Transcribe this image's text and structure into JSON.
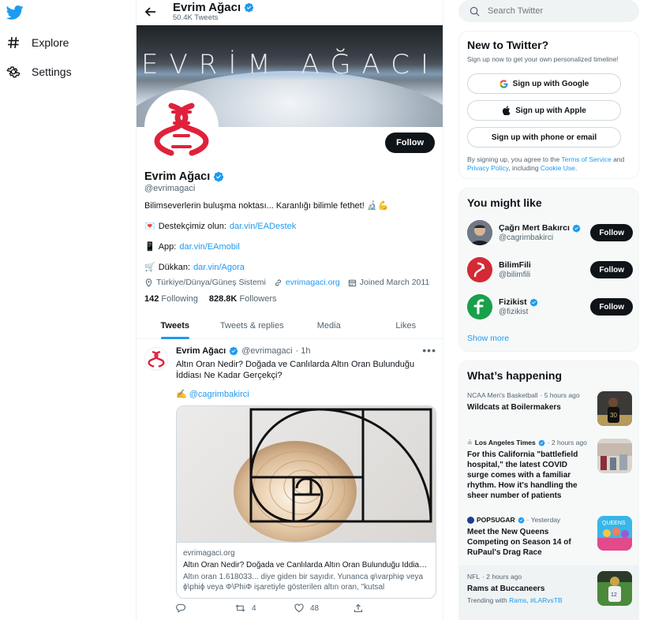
{
  "nav": {
    "items": [
      {
        "label": "Explore",
        "icon": "hashtag-icon"
      },
      {
        "label": "Settings",
        "icon": "gear-icon"
      }
    ]
  },
  "topbar": {
    "name": "Evrim Ağacı",
    "tweets_count": "50.4K Tweets"
  },
  "banner": {
    "text": "EVRİM AĞACI"
  },
  "profile": {
    "name": "Evrim Ağacı",
    "handle": "@evrimagaci",
    "follow_label": "Follow",
    "bio": "Bilimseverlerin buluşma noktası... Karanlığı bilimle fethet! 🔬💪",
    "support_prefix": "Destekçimiz olun: ",
    "support_link": "dar.vin/EADestek",
    "app_prefix": "App: ",
    "app_link": "dar.vin/EAmobil",
    "shop_prefix": "Dükkan: ",
    "shop_link": "dar.vin/Agora",
    "location": "Türkiye/Dünya/Güneş Sistemi",
    "website": "evrimagaci.org",
    "joined": "Joined March 2011",
    "following_count": "142",
    "following_label": "Following",
    "followers_count": "828.8K",
    "followers_label": "Followers"
  },
  "tabs": [
    {
      "label": "Tweets",
      "active": true
    },
    {
      "label": "Tweets & replies",
      "active": false
    },
    {
      "label": "Media",
      "active": false
    },
    {
      "label": "Likes",
      "active": false
    }
  ],
  "tweet": {
    "name": "Evrim Ağacı",
    "handle": "@evrimagaci",
    "time": "· 1h",
    "text": "Altın Oran Nedir? Doğada ve Canlılarda Altın Oran Bulunduğu İddiası Ne Kadar Gerçekçi?",
    "mention_prefix": "✍️ ",
    "mention": "@cagrimbakirci",
    "card_domain": "evrimagaci.org",
    "card_title": "Altın Oran Nedir? Doğada ve Canlılarda Altın Oran Bulunduğu İddiası ...",
    "card_desc": "Altın oran 1.618033... diye giden bir sayıdır. Yunanca φ\\varphiφ veya ϕ\\phiϕ veya Φ\\PhiΦ işaretiyle gösterilen altın oran, \"kutsal",
    "retweets": "4",
    "likes": "48"
  },
  "search": {
    "placeholder": "Search Twitter"
  },
  "new_to_twitter": {
    "title": "New to Twitter?",
    "subtitle": "Sign up now to get your own personalized timeline!",
    "google_label": "Sign up with Google",
    "apple_label": "Sign up with Apple",
    "phone_label": "Sign up with phone or email",
    "terms_prefix": "By signing up, you agree to the ",
    "terms_link": "Terms of Service",
    "terms_and": " and ",
    "privacy_link": "Privacy Policy",
    "terms_including": ", including ",
    "cookie_link": "Cookie Use",
    "terms_end": "."
  },
  "who_to_follow": {
    "title": "You might like",
    "accounts": [
      {
        "name": "Çağrı Mert Bakırcı",
        "handle": "@cagrimbakirci",
        "verified": true,
        "button": "Follow"
      },
      {
        "name": "BilimFili",
        "handle": "@bilimfili",
        "verified": false,
        "button": "Follow"
      },
      {
        "name": "Fizikist",
        "handle": "@fizikist",
        "verified": true,
        "button": "Follow"
      }
    ],
    "show_more": "Show more"
  },
  "trends": {
    "title": "What’s happening",
    "items": [
      {
        "meta": "NCAA Men's Basketball",
        "time": "· 5 hours ago",
        "title": "Wildcats at Boilermakers"
      },
      {
        "meta": "Los Angeles Times",
        "time": "· 2 hours ago",
        "title": "For this California \"battlefield hospital,\" the latest COVID surge comes with a familiar rhythm. How it's handling the sheer number of patients"
      },
      {
        "meta": "POPSUGAR",
        "time": "· Yesterday",
        "title": "Meet the New Queens Competing on Season 14 of RuPaul's Drag Race"
      },
      {
        "meta": "NFL",
        "time": "· 2 hours ago",
        "title": "Rams at Buccaneers",
        "sub_prefix": "Trending with ",
        "sub_a": "Rams",
        "sub_sep": ", ",
        "sub_b": "#LARvsTB"
      }
    ]
  },
  "colors": {
    "accent": "#1d9bf0",
    "text": "#0f1419",
    "muted": "#536471",
    "logo_red": "#e0213b"
  }
}
